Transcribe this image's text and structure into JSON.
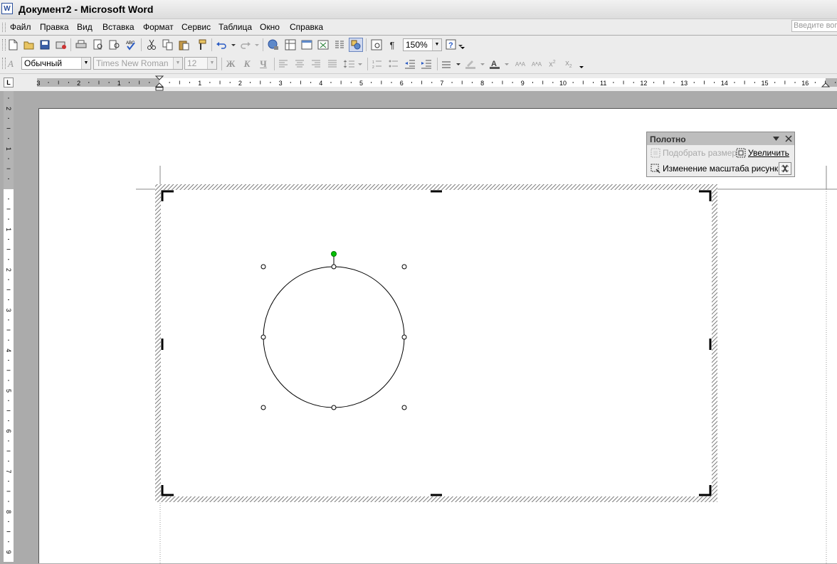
{
  "window": {
    "title": "Документ2 - Microsoft Word",
    "icon_letter": "W"
  },
  "menu": {
    "items": [
      "Файл",
      "Правка",
      "Вид",
      "Вставка",
      "Формат",
      "Сервис",
      "Таблица",
      "Окно",
      "Справка"
    ],
    "help_placeholder": "Введите вопрос"
  },
  "standard_toolbar": {
    "icons": [
      "new-icon",
      "open-icon",
      "save-icon",
      "permission-icon",
      "print-icon",
      "print-preview-icon",
      "research-icon",
      "spelling-icon",
      "cut-icon",
      "copy-icon",
      "paste-icon",
      "format-painter-icon",
      "undo-icon",
      "redo-icon",
      "hyperlink-icon",
      "tables-borders-icon",
      "insert-table-icon",
      "insert-excel-icon",
      "columns-icon",
      "drawing-icon",
      "document-map-icon",
      "show-hide-icon",
      "help-icon"
    ],
    "zoom": "150%"
  },
  "formatting_toolbar": {
    "style": "Обычный",
    "font": "Times New Roman",
    "size": "12",
    "bold": "Ж",
    "italic": "К",
    "underline": "Ч",
    "pilcrow": "¶"
  },
  "ruler": {
    "h_numbers": [
      "3",
      "2",
      "1",
      "1",
      "2",
      "3",
      "4",
      "5",
      "6",
      "7",
      "8",
      "9",
      "10",
      "11",
      "12",
      "13",
      "14",
      "15",
      "16"
    ],
    "v_numbers": [
      "2",
      "1",
      "1",
      "2",
      "3",
      "4",
      "5",
      "6",
      "7",
      "8",
      "9"
    ]
  },
  "canvas_toolbar": {
    "title": "Полотно",
    "fit_label": "Подобрать размер",
    "expand_label": "Увеличить",
    "scale_label": "Изменение масштаба рисунка"
  },
  "colors": {
    "rotation_handle": "#00c000",
    "selection_hatch": "#7a7a7a",
    "page": "#ffffff",
    "workspace": "#ababab"
  }
}
